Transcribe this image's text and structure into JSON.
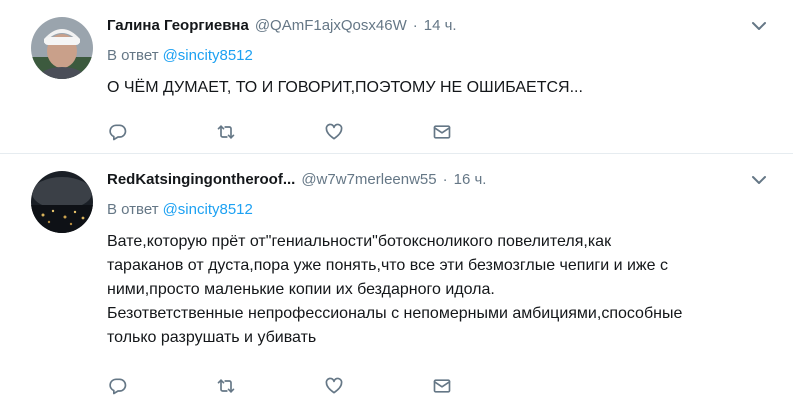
{
  "tweets": [
    {
      "name": "Галина Георгиевна",
      "handle": "@QAmF1ajxQosx46W",
      "separator": "·",
      "time": "14 ч.",
      "reply_prefix": "В ответ",
      "reply_user": "@sincity8512",
      "text": "О ЧЁМ ДУМАЕТ, ТО И ГОВОРИТ,ПОЭТОМУ НЕ ОШИБАЕТСЯ..."
    },
    {
      "name": "RedKatsingingontheroof...",
      "handle": "@w7w7merleenw55",
      "separator": "·",
      "time": "16 ч.",
      "reply_prefix": "В ответ",
      "reply_user": "@sincity8512",
      "lines": [
        "Вате,которую прёт от\"гениальности\"ботоксноликого повелителя,как",
        "тараканов от дуста,пора уже понять,что все эти безмозглые чепиги и иже с",
        "ними,просто маленькие копии их бездарного идола.",
        "Безответственные непрофессионалы с непомерными амбициями,способные",
        "только разрушать и убивать"
      ]
    }
  ],
  "icons": [
    "reply-icon",
    "retweet-icon",
    "like-icon",
    "message-icon",
    "caret-down-icon"
  ],
  "colors": {
    "link": "#1da1f2",
    "muted": "#657786",
    "text": "#14171a",
    "divider": "#e6ecf0"
  }
}
